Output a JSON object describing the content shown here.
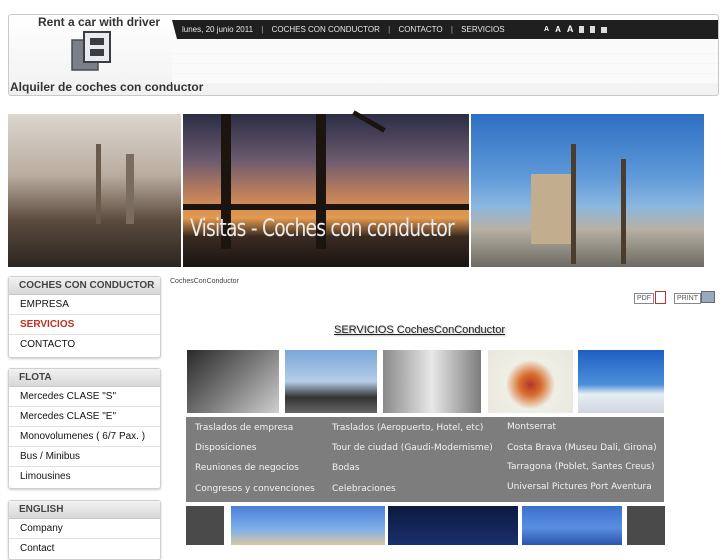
{
  "header": {
    "logo_top": "Rent a car with driver",
    "logo_bottom": "Alquiler de coches con conductor",
    "date": "lunes, 20 junio 2011",
    "nav": [
      "COCHES CON CONDUCTOR",
      "CONTACTO",
      "SERVICIOS"
    ],
    "font_sizes": [
      "A",
      "A",
      "A"
    ]
  },
  "banner": {
    "text": "Visitas - Coches con conductor"
  },
  "sidebar": {
    "menus": [
      {
        "title": "COCHES CON CONDUCTOR",
        "items": [
          "EMPRESA",
          "SERVICIOS",
          "CONTACTO"
        ],
        "active": "SERVICIOS"
      },
      {
        "title": "FLOTA",
        "items": [
          "Mercedes CLASE \"S\"",
          "Mercedes CLASE \"E\"",
          "Monovolumenes ( 6/7 Pax. )",
          "Bus / Minibus",
          "Limousines"
        ]
      },
      {
        "title": "ENGLISH",
        "items": [
          "Company",
          "Contact"
        ]
      }
    ]
  },
  "content": {
    "breadcrumb": "CochesConConductor",
    "pdf_label": "PDF",
    "print_label": "PRINT",
    "title": "SERVICIOS CochesConConductor",
    "services": {
      "col1": [
        "Traslados de empresa",
        "Disposiciones",
        "Reuniones de negocios",
        "Congresos y convenciones"
      ],
      "col2": [
        "Traslados (Aeropuerto, Hotel, etc)",
        "Tour de ciudad (Gaudi-Modernisme)",
        "Bodas",
        "Celebraciones"
      ],
      "col3": [
        "Montserrat",
        "Costa Brava (Museu Dali, Girona)",
        "Tarragona (Poblet, Santes Creus)",
        "Universal Pictures Port Aventura"
      ]
    }
  },
  "colors": {
    "topbar": "#1f1f1f",
    "active_menu": "#c0301d",
    "services_bg": "#7d7d7d"
  }
}
